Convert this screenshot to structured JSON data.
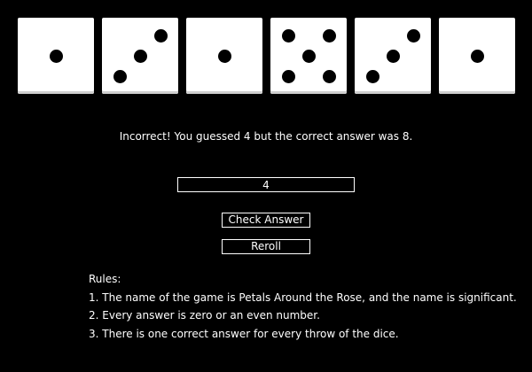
{
  "dice": [
    {
      "value": 1
    },
    {
      "value": 3
    },
    {
      "value": 1
    },
    {
      "value": 5
    },
    {
      "value": 3
    },
    {
      "value": 1
    }
  ],
  "message": "Incorrect! You guessed 4 but the correct answer was 8.",
  "answer": {
    "value": "4"
  },
  "buttons": {
    "check": "Check Answer",
    "reroll": "Reroll"
  },
  "rules": {
    "title": "Rules:",
    "items": [
      "1. The name of the game is Petals Around the Rose, and the name is significant.",
      "2. Every answer is zero or an even number.",
      "3. There is one correct answer for every throw of the dice."
    ]
  },
  "colors": {
    "background": "#000000",
    "die_face": "#ffffff",
    "pip": "#000000",
    "text": "#ffffff"
  }
}
